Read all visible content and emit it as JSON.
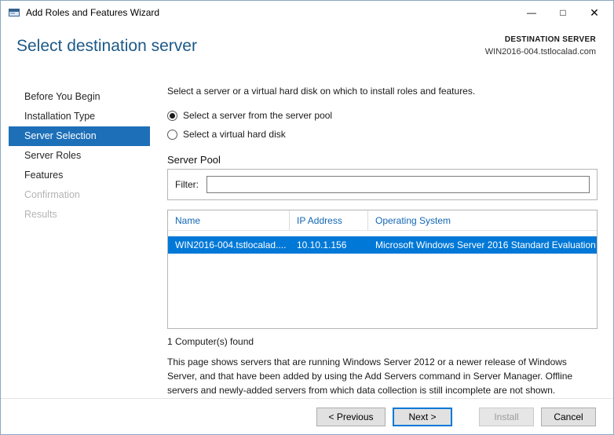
{
  "window": {
    "title": "Add Roles and Features Wizard",
    "controls": {
      "minimize": "—",
      "maximize": "□",
      "close": "✕"
    }
  },
  "header": {
    "title": "Select destination server",
    "destination_label": "DESTINATION SERVER",
    "destination_server": "WIN2016-004.tstlocalad.com"
  },
  "sidebar": {
    "items": [
      {
        "label": "Before You Begin",
        "state": "enabled"
      },
      {
        "label": "Installation Type",
        "state": "enabled"
      },
      {
        "label": "Server Selection",
        "state": "selected"
      },
      {
        "label": "Server Roles",
        "state": "enabled"
      },
      {
        "label": "Features",
        "state": "enabled"
      },
      {
        "label": "Confirmation",
        "state": "disabled"
      },
      {
        "label": "Results",
        "state": "disabled"
      }
    ]
  },
  "main": {
    "intro": "Select a server or a virtual hard disk on which to install roles and features.",
    "radios": [
      {
        "label": "Select a server from the server pool",
        "checked": true
      },
      {
        "label": "Select a virtual hard disk",
        "checked": false
      }
    ],
    "server_pool_label": "Server Pool",
    "filter_label": "Filter:",
    "filter_value": "",
    "table": {
      "columns": [
        "Name",
        "IP Address",
        "Operating System"
      ],
      "rows": [
        {
          "cells": [
            "WIN2016-004.tstlocalad....",
            "10.10.1.156",
            "Microsoft Windows Server 2016 Standard Evaluation"
          ],
          "selected": true
        }
      ]
    },
    "computers_found": "1 Computer(s) found",
    "description": "This page shows servers that are running Windows Server 2012 or a newer release of Windows Server, and that have been added by using the Add Servers command in Server Manager. Offline servers and newly-added servers from which data collection is still incomplete are not shown."
  },
  "footer": {
    "previous_label": "< Previous",
    "next_label": "Next >",
    "install_label": "Install",
    "cancel_label": "Cancel"
  },
  "colors": {
    "accent": "#0078d7",
    "title_text": "#1d5987",
    "nav_selected": "#1d6fb8",
    "table_header_text": "#1267b5",
    "disabled_text": "#b4b4b4"
  }
}
